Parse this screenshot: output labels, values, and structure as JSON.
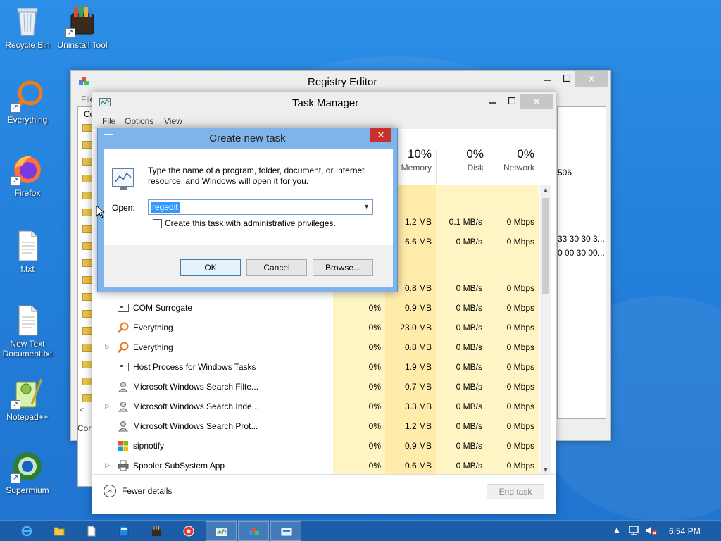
{
  "desktop": {
    "icons": [
      {
        "label": "Recycle Bin",
        "icon": "recycle-bin-icon"
      },
      {
        "label": "Uninstall Tool",
        "icon": "uninstall-tool-icon"
      },
      {
        "label": "Everything",
        "icon": "everything-icon"
      },
      {
        "label": "Firefox",
        "icon": "firefox-icon"
      },
      {
        "label": "f.txt",
        "icon": "text-file-icon"
      },
      {
        "label": "New Text Document.txt",
        "icon": "text-file-icon"
      },
      {
        "label": "Notepad++",
        "icon": "notepadpp-icon"
      },
      {
        "label": "Supermium",
        "icon": "supermium-icon"
      }
    ]
  },
  "registry_editor": {
    "title": "Registry Editor",
    "menu_partial": "File",
    "tree_partial": "Co",
    "status_partial": "Cor",
    "right_values": [
      "506",
      "33 30 30 3...",
      "0 00 30 00..."
    ]
  },
  "task_manager": {
    "title": "Task Manager",
    "menu": [
      "File",
      "Options",
      "View"
    ],
    "columns": [
      {
        "pct": "10%",
        "name": "Memory"
      },
      {
        "pct": "0%",
        "name": "Disk"
      },
      {
        "pct": "0%",
        "name": "Network"
      }
    ],
    "rows_partial": [
      {
        "memory": "1.2 MB",
        "disk": "0.1 MB/s",
        "network": "0 Mbps"
      },
      {
        "memory": "6.6 MB",
        "disk": "0 MB/s",
        "network": "0 Mbps"
      },
      {
        "memory": "0.8 MB",
        "disk": "0 MB/s",
        "network": "0 Mbps"
      }
    ],
    "rows": [
      {
        "name": "COM Surrogate",
        "expand": false,
        "cpu": "0%",
        "memory": "0.9 MB",
        "disk": "0 MB/s",
        "network": "0 Mbps"
      },
      {
        "name": "Everything",
        "expand": false,
        "cpu": "0%",
        "memory": "23.0 MB",
        "disk": "0 MB/s",
        "network": "0 Mbps"
      },
      {
        "name": "Everything",
        "expand": true,
        "cpu": "0%",
        "memory": "0.8 MB",
        "disk": "0 MB/s",
        "network": "0 Mbps"
      },
      {
        "name": "Host Process for Windows Tasks",
        "expand": false,
        "cpu": "0%",
        "memory": "1.9 MB",
        "disk": "0 MB/s",
        "network": "0 Mbps"
      },
      {
        "name": "Microsoft Windows Search Filte...",
        "expand": false,
        "cpu": "0%",
        "memory": "0.7 MB",
        "disk": "0 MB/s",
        "network": "0 Mbps"
      },
      {
        "name": "Microsoft Windows Search Inde...",
        "expand": true,
        "cpu": "0%",
        "memory": "3.3 MB",
        "disk": "0 MB/s",
        "network": "0 Mbps"
      },
      {
        "name": "Microsoft Windows Search Prot...",
        "expand": false,
        "cpu": "0%",
        "memory": "1.2 MB",
        "disk": "0 MB/s",
        "network": "0 Mbps"
      },
      {
        "name": "sipnotify",
        "expand": false,
        "cpu": "0%",
        "memory": "0.9 MB",
        "disk": "0 MB/s",
        "network": "0 Mbps"
      },
      {
        "name": "Spooler SubSystem App",
        "expand": true,
        "cpu": "0%",
        "memory": "0.6 MB",
        "disk": "0 MB/s",
        "network": "0 Mbps"
      }
    ],
    "fewer_details": "Fewer details",
    "end_task": "End task"
  },
  "dialog": {
    "title": "Create new task",
    "close_glyph": "✕",
    "prompt": "Type the name of a program, folder, document, or Internet resource, and Windows will open it for you.",
    "open_label": "Open:",
    "open_value": "regedit",
    "admin_label": "Create this task with administrative privileges.",
    "ok": "OK",
    "cancel": "Cancel",
    "browse": "Browse..."
  },
  "taskbar": {
    "clock": "6:54 PM"
  },
  "colors": {
    "accent": "#3399ff",
    "dialog_frame": "#7eb4ea",
    "close_red": "#c9302c",
    "heat_yellow": "#fff4c4"
  }
}
